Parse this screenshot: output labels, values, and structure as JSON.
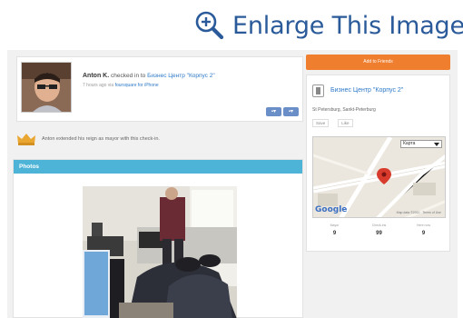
{
  "enlarge": {
    "label": "Enlarge This Image",
    "icon": "zoom-in-icon"
  },
  "checkin": {
    "user": "Anton K.",
    "action": "checked in to",
    "venue": "Бизнес Центр \"Корпус 2\"",
    "meta_prefix": "7 hours ago via",
    "meta_app": "foursquare for iPhone",
    "action_icons": [
      "comment-icon",
      "share-icon"
    ]
  },
  "mayor": {
    "text": "Anton extended his reign as mayor with this check-in."
  },
  "photos": {
    "header": "Photos"
  },
  "sidebar": {
    "add_button": "Add to Friends",
    "venue_name": "Бизнес Центр \"Корпус 2\"",
    "address": "St Petersburg, Sankt-Peterburg",
    "tags": [
      "Save",
      "Like"
    ],
    "map_select": "Карта",
    "map_logo": "Google",
    "map_footer": "Map data ©2011 · Terms of Use",
    "stats": [
      {
        "label": "Mayor",
        "value": "9"
      },
      {
        "label": "Check-ins",
        "value": "99"
      },
      {
        "label": "Here now",
        "value": "9"
      }
    ]
  },
  "colors": {
    "accent_blue": "#2d79c7",
    "header_blue": "#4db4d8",
    "button_orange": "#ef7e2e",
    "crown_gold": "#e9a630"
  }
}
